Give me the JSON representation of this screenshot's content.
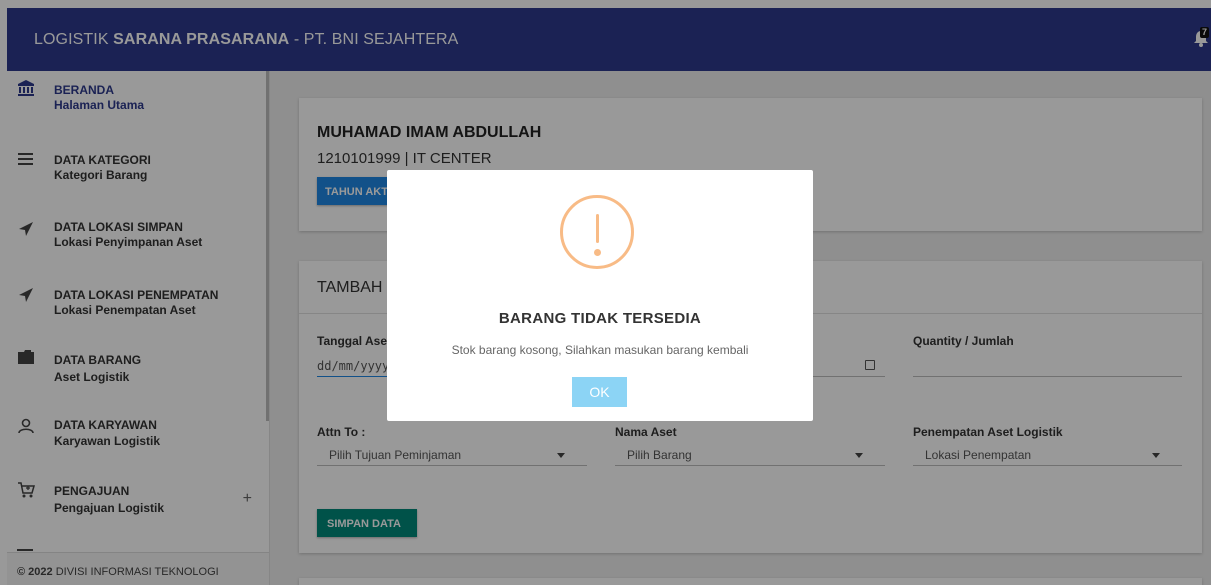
{
  "topbar": {
    "title_pre": "LOGISTIK ",
    "title_bold": "SARANA PRASARANA",
    "title_post": " - PT. BNI SEJAHTERA",
    "notif_count": "7"
  },
  "sidebar": {
    "items": [
      {
        "title": "BERANDA",
        "subtitle": "Halaman Utama",
        "icon": "bank-icon"
      },
      {
        "title": "DATA KATEGORI",
        "subtitle": "Kategori Barang",
        "icon": "list-icon"
      },
      {
        "title": "DATA LOKASI SIMPAN",
        "subtitle": "Lokasi Penyimpanan Aset",
        "icon": "navigation-arrow-icon"
      },
      {
        "title": "DATA LOKASI PENEMPATAN",
        "subtitle": "Lokasi Penempatan Aset",
        "icon": "navigation-arrow-icon"
      },
      {
        "title": "DATA BARANG",
        "subtitle": "Aset Logistik",
        "icon": "folder-icon"
      },
      {
        "title": "DATA KARYAWAN",
        "subtitle": "Karyawan Logistik",
        "icon": "user-icon"
      },
      {
        "title": "PENGAJUAN",
        "subtitle": "Pengajuan Logistik",
        "icon": "cart-icon",
        "expand": "+"
      }
    ],
    "footer_year": "© 2022",
    "footer_text": " DIVISI INFORMASI TEKNOLOGI"
  },
  "profile": {
    "name": "MUHAMAD IMAM ABDULLAH",
    "info": "1210101999 | IT CENTER",
    "button": "TAHUN AKTIF"
  },
  "form": {
    "title": "TAMBAH",
    "date_label": "Tanggal Aset",
    "date_placeholder": "dd/mm/yyyy",
    "qty_label": "Quantity / Jumlah",
    "attn_label": "Attn To :",
    "attn_value": "Pilih Tujuan Peminjaman",
    "aset_label": "Nama Aset",
    "aset_value": "Pilih Barang",
    "penempatan_label": "Penempatan Aset Logistik",
    "penempatan_value": "Lokasi Penempatan",
    "save": "SIMPAN DATA"
  },
  "modal": {
    "title": "BARANG TIDAK TERSEDIA",
    "text": "Stok barang kosong, Silahkan masukan barang kembali",
    "ok": "OK",
    "icon_color": "#f8bb86",
    "ok_color": "#8cd4f5"
  },
  "colors": {
    "topbar": "#2d3a8c",
    "nav_text": "#2d3a8c",
    "primary_button": "#1e88e5",
    "save_button": "#00897b"
  }
}
